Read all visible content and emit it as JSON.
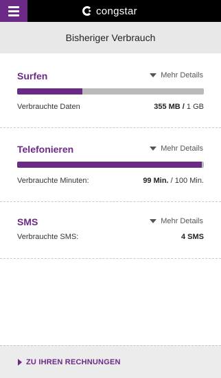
{
  "app": {
    "brand": "congstar",
    "header_title": "Bisheriger Verbrauch",
    "accent_color": "#6b2a85"
  },
  "sections": [
    {
      "title": "Surfen",
      "details_label": "Mehr Details",
      "progress": 0.35,
      "usage_label": "Verbrauchte Daten",
      "used": "355 MB",
      "separator": "/",
      "limit": "1 GB"
    },
    {
      "title": "Telefonieren",
      "details_label": "Mehr Details",
      "progress": 0.99,
      "usage_label": "Verbrauchte Minuten:",
      "used": "99 Min.",
      "separator": "/",
      "limit": "100 Min."
    },
    {
      "title": "SMS",
      "details_label": "Mehr Details",
      "usage_label": "Verbrauchte SMS:",
      "used": "4 SMS"
    }
  ],
  "footer": {
    "link_label": "ZU IHREN RECHNUNGEN"
  },
  "icons": {
    "menu": "hamburger-icon",
    "brand": "congstar-logo-icon",
    "details": "triangle-down-icon",
    "footer": "triangle-right-icon"
  }
}
